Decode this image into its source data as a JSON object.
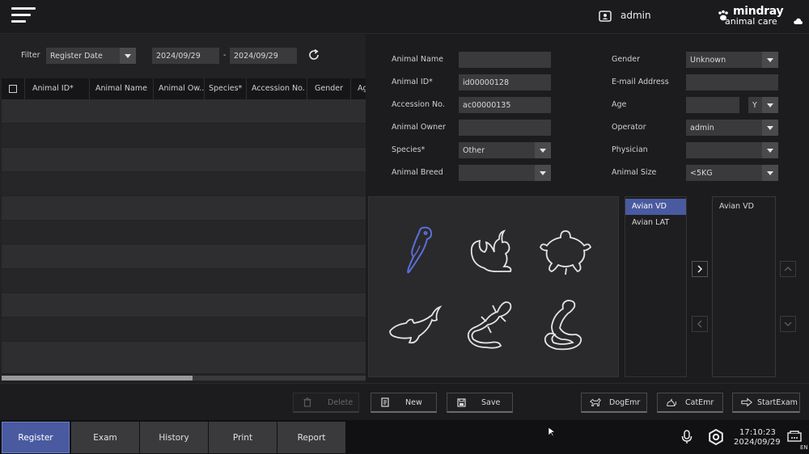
{
  "header": {
    "user": "admin",
    "brand_line1": "mindray",
    "brand_line2": "animal care"
  },
  "filter": {
    "label": "Filter",
    "field": "Register Date",
    "date_from": "2024/09/29",
    "separator": "-",
    "date_to": "2024/09/29"
  },
  "table": {
    "columns": [
      "Animal ID*",
      "Animal Name",
      "Animal Ow...",
      "Species*",
      "Accession No.",
      "Gender",
      "Ag"
    ]
  },
  "form": {
    "animal_name_label": "Animal Name",
    "animal_name_value": "",
    "animal_id_label": "Animal ID*",
    "animal_id_value": "id00000128",
    "accession_label": "Accession No.",
    "accession_value": "ac00000135",
    "owner_label": "Animal Owner",
    "owner_value": "",
    "species_label": "Species*",
    "species_value": "Other",
    "breed_label": "Animal Breed",
    "breed_value": "",
    "gender_label": "Gender",
    "gender_value": "Unknown",
    "email_label": "E-mail Address",
    "email_value": "",
    "age_label": "Age",
    "age_value": "",
    "age_unit": "Y",
    "operator_label": "Operator",
    "operator_value": "admin",
    "physician_label": "Physician",
    "physician_value": "",
    "size_label": "Animal Size",
    "size_value": "<5KG"
  },
  "species_icons": [
    "parrot-icon",
    "squirrel-icon",
    "turtle-icon",
    "dolphin-icon",
    "lizard-icon",
    "snake-icon"
  ],
  "views": {
    "available": [
      "Avian VD",
      "Avian LAT"
    ],
    "selected": [
      "Avian VD"
    ]
  },
  "actions": {
    "delete": "Delete",
    "new": "New",
    "save": "Save",
    "dog_emr": "DogEmr",
    "cat_emr": "CatEmr",
    "start_exam": "StartExam"
  },
  "nav": {
    "tabs": [
      "Register",
      "Exam",
      "History",
      "Print",
      "Report"
    ],
    "active": "Register"
  },
  "status": {
    "time": "17:10:23",
    "date": "2024/09/29",
    "lang": "EN"
  },
  "colors": {
    "accent": "#4a5aa0",
    "selected_species": "#5b6fd8"
  }
}
